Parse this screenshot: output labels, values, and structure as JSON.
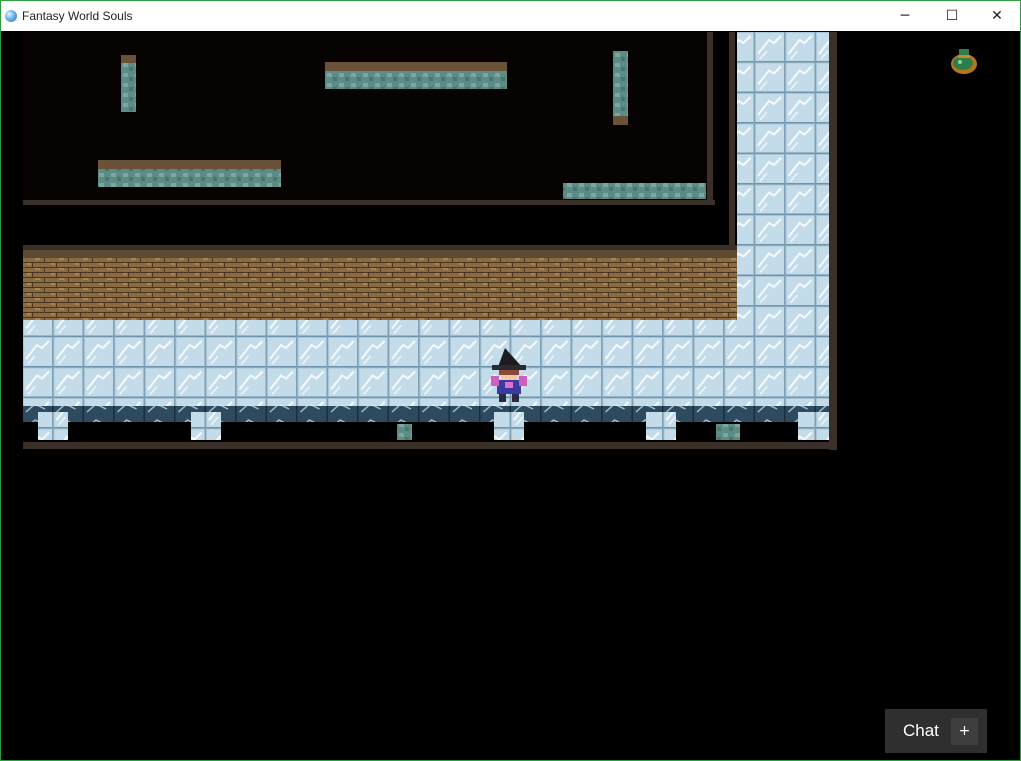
{
  "window": {
    "title": "Fantasy World Souls",
    "app_icon": "globe-icon",
    "controls": {
      "minimize": "─",
      "maximize": "☐",
      "close": "✕"
    }
  },
  "game": {
    "corner_icon": "money-bag-icon",
    "player": {
      "name": "",
      "appearance": "witch-hat-mage"
    }
  },
  "chat": {
    "label": "Chat",
    "expand": "+"
  },
  "colors": {
    "void": "#000000",
    "room_floor": "#080303",
    "brick": "#8a6a40",
    "ice": "#b4d2e4",
    "stone_ledge": "#5f8a82"
  }
}
